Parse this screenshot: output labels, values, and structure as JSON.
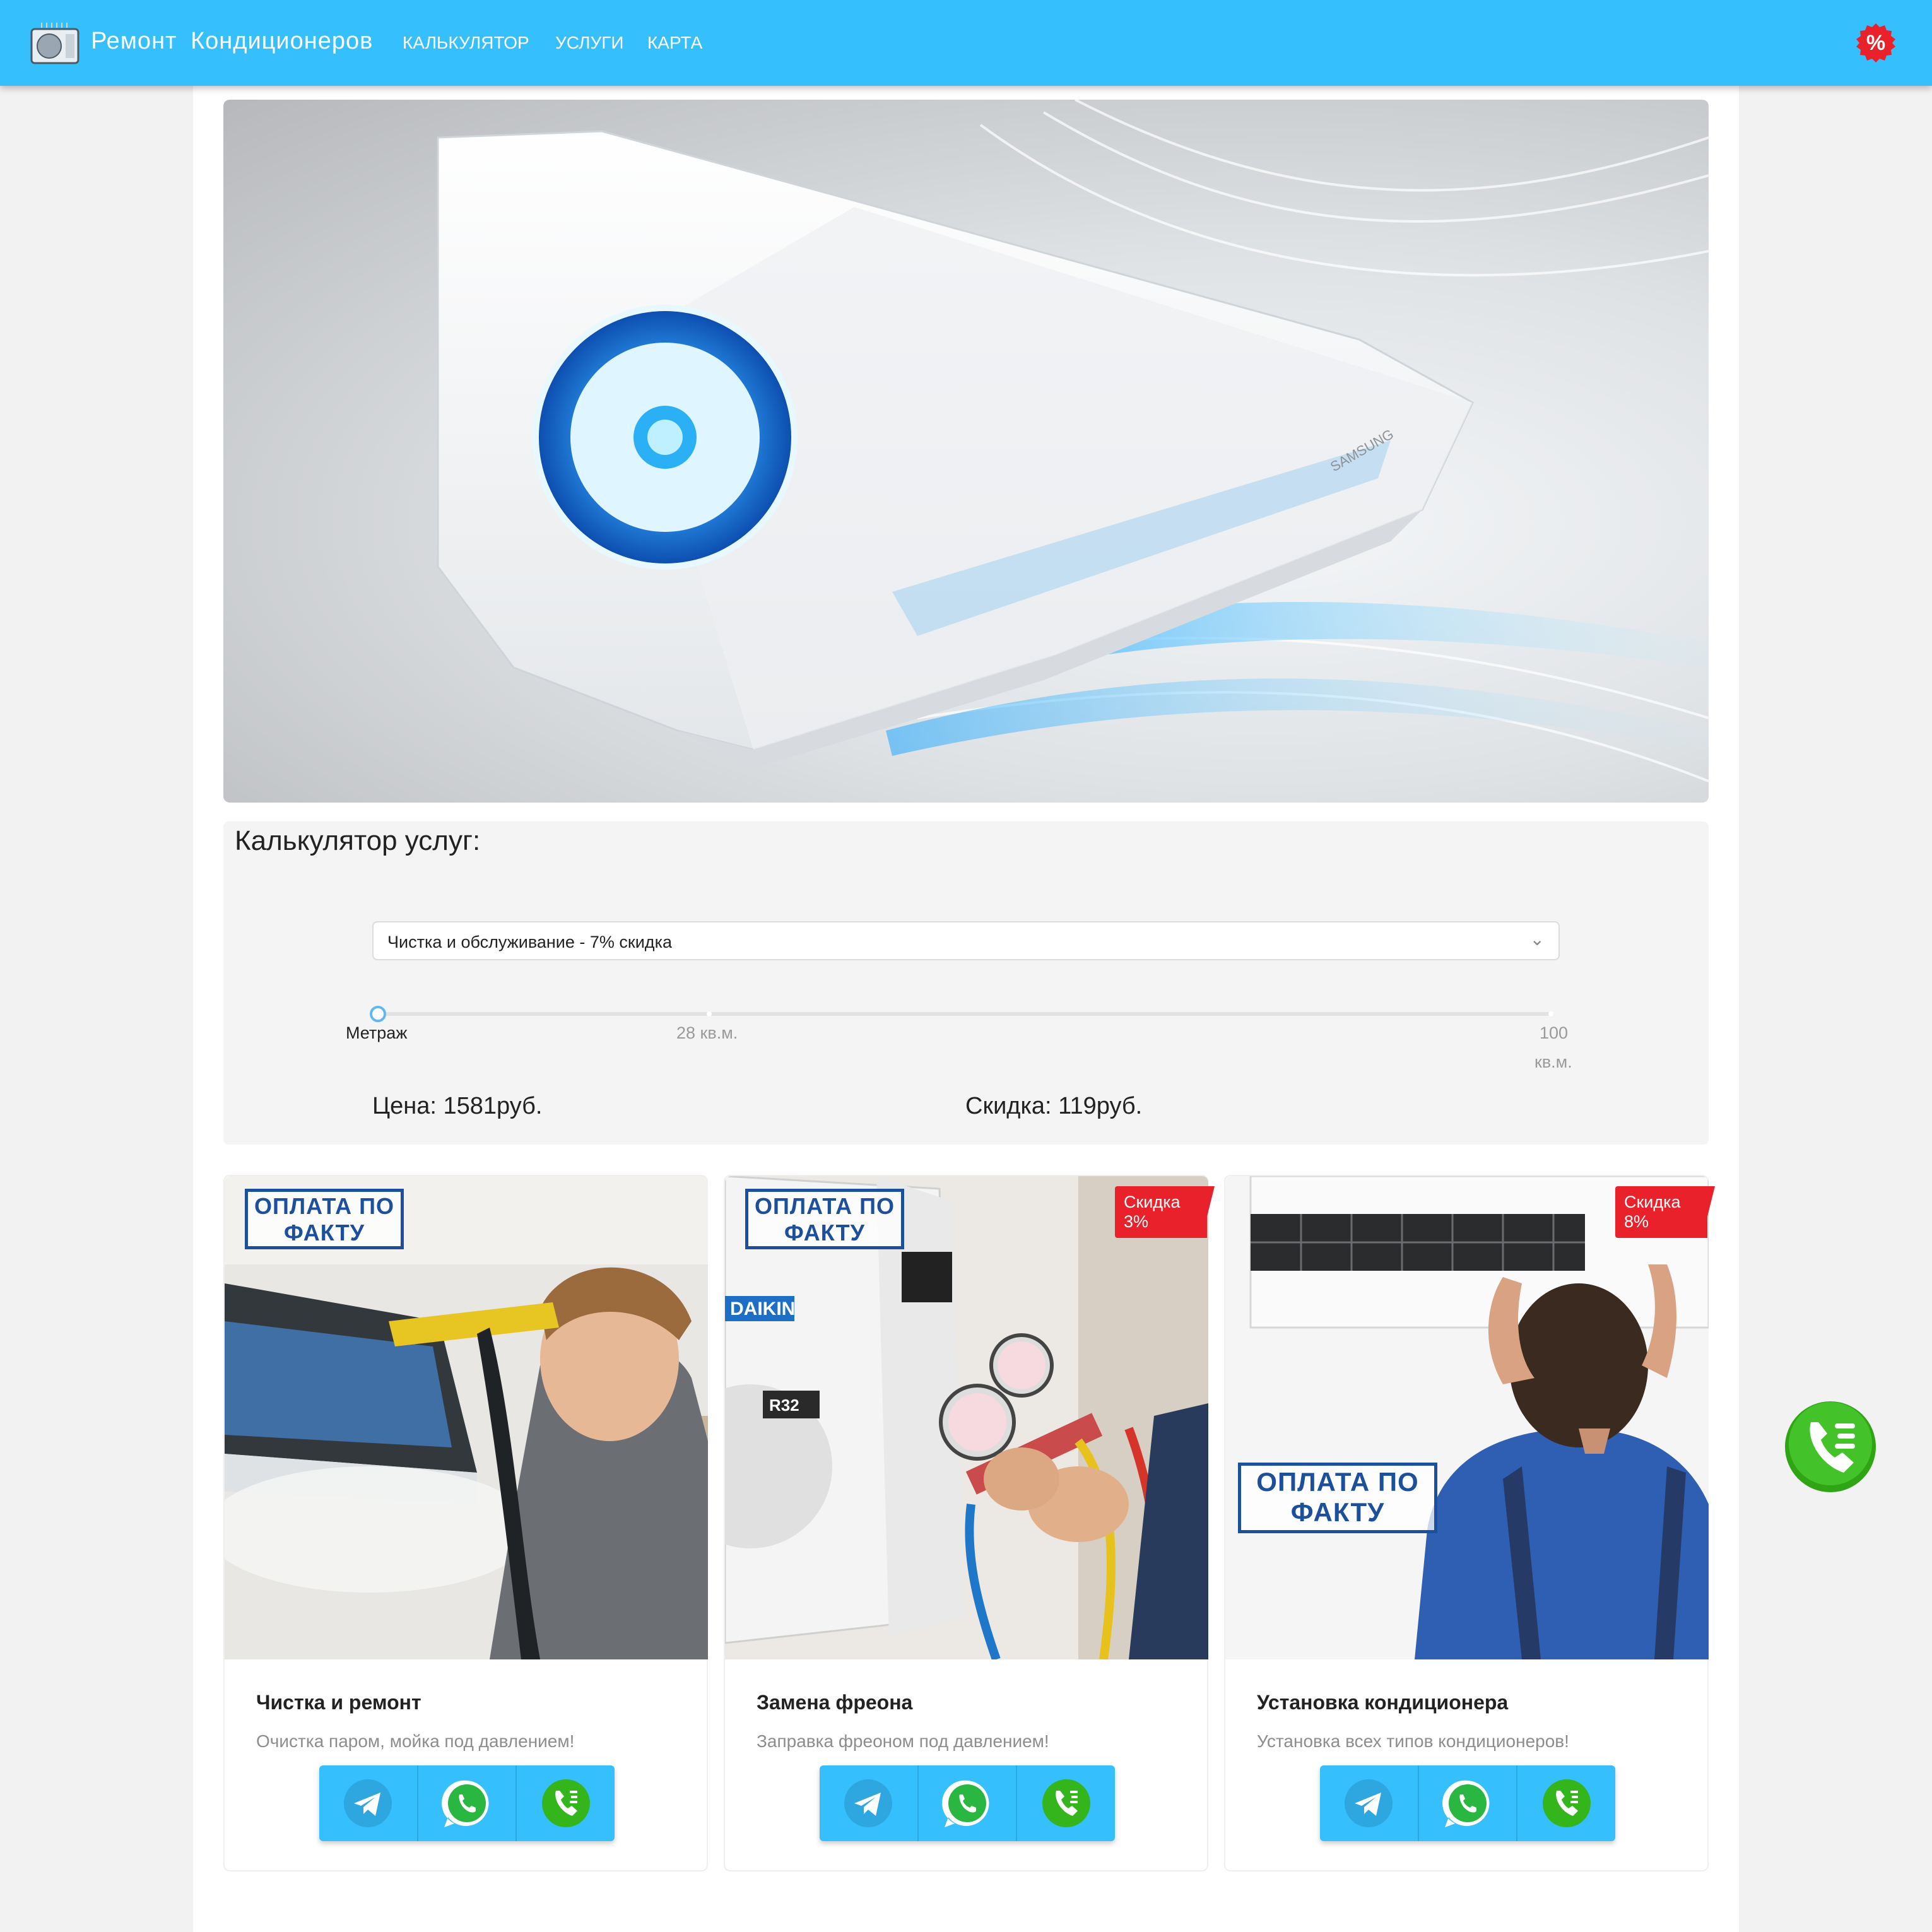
{
  "header": {
    "brand": "Ремонт Кондиционеров",
    "nav": [
      "КАЛЬКУЛЯТОР",
      "УСЛУГИ",
      "КАРТА"
    ],
    "promo_symbol": "%",
    "bg_color": "#36bffd"
  },
  "hero": {
    "image": "air-conditioner-unit",
    "logo_text": "SAMSUNG"
  },
  "calculator": {
    "title": "Калькулятор услуг:",
    "selected_service": "Чистка и обслуживание - 7% скидка",
    "slider": {
      "label": "Метраж",
      "min_value": 0,
      "mid_label": "28 кв.м.",
      "max_label_top": "100",
      "max_label_bottom": "кв.м.",
      "value_fraction": 0
    },
    "price": "Цена: 1581руб.",
    "discount": "Скидка: 119руб."
  },
  "cards": [
    {
      "title": "Чистка и ремонт",
      "desc": "Очистка паром, мойка под давлением!",
      "pay_badge_line1": "ОПЛАТА ПО",
      "pay_badge_line2": "ФАКТУ",
      "discount": ""
    },
    {
      "title": "Замена фреона",
      "desc": "Заправка фреоном под давлением!",
      "pay_badge_line1": "ОПЛАТА ПО",
      "pay_badge_line2": "ФАКТУ",
      "discount": "Скидка 3%",
      "brand_text": "DAIKIN",
      "refrigerant": "R32"
    },
    {
      "title": "Установка кондиционера",
      "desc": "Установка всех типов кондиционеров!",
      "pay_badge_line1": "ОПЛАТА ПО",
      "pay_badge_line2": "ФАКТУ",
      "discount": "Скидка 8%"
    }
  ],
  "icons": {
    "telegram": "telegram-icon",
    "whatsapp": "whatsapp-icon",
    "phone": "phone-icon"
  },
  "colors": {
    "accent": "#36bffd",
    "badge_red": "#e8212b",
    "pay_blue": "#1c4f9c",
    "call_green": "#34b51c"
  }
}
